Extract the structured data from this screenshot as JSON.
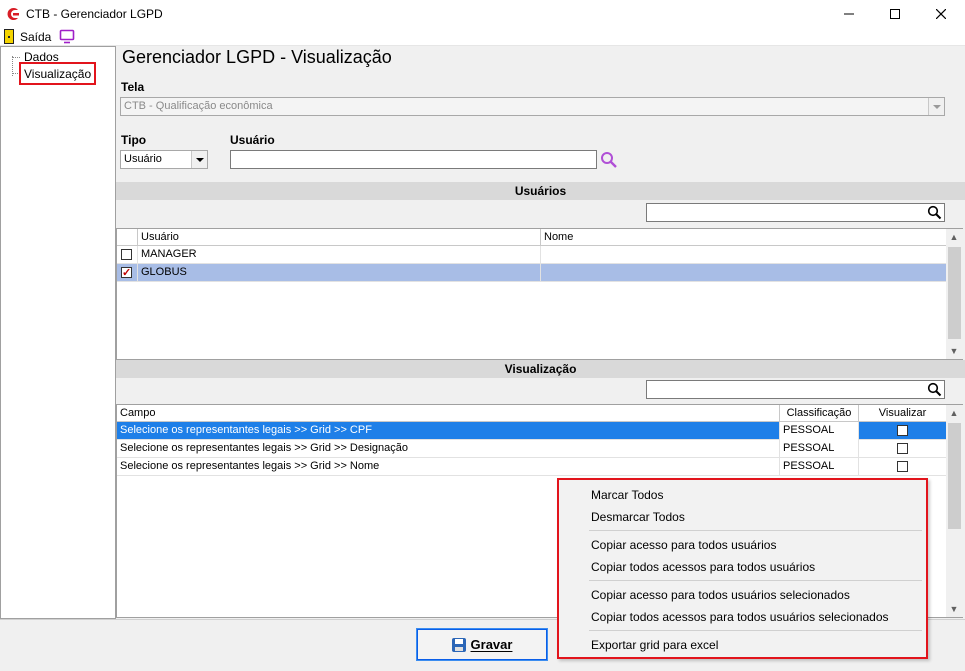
{
  "window": {
    "title": "CTB - Gerenciador LGPD"
  },
  "menubar": {
    "exit_label": "Saída"
  },
  "tree": {
    "items": [
      "Dados",
      "Visualização"
    ]
  },
  "page": {
    "title": "Gerenciador LGPD - Visualização"
  },
  "tela": {
    "label": "Tela",
    "value": "CTB - Qualificação econômica"
  },
  "tipo": {
    "label": "Tipo",
    "value": "Usuário"
  },
  "usuario": {
    "label": "Usuário",
    "value": ""
  },
  "usuarios_section": {
    "title": "Usuários",
    "search_value": "",
    "columns": [
      "Usuário",
      "Nome"
    ],
    "rows": [
      {
        "checked": false,
        "usuario": "MANAGER",
        "nome": ""
      },
      {
        "checked": true,
        "usuario": "GLOBUS",
        "nome": ""
      }
    ]
  },
  "visualizacao_section": {
    "title": "Visualização",
    "search_value": "",
    "columns": [
      "Campo",
      "Classificação",
      "Visualizar"
    ],
    "rows": [
      {
        "campo": "Selecione os representantes legais >> Grid >> CPF",
        "classificacao": "PESSOAL",
        "visualizar": false
      },
      {
        "campo": "Selecione os representantes legais >> Grid >> Designação",
        "classificacao": "PESSOAL",
        "visualizar": false
      },
      {
        "campo": "Selecione os representantes legais >> Grid >> Nome",
        "classificacao": "PESSOAL",
        "visualizar": false
      }
    ]
  },
  "footer": {
    "save_label": "Gravar"
  },
  "context_menu": {
    "items": [
      "Marcar Todos",
      "Desmarcar Todos",
      "Copiar acesso para todos usuários",
      "Copiar todos acessos para todos usuários",
      "Copiar acesso para todos usuários selecionados",
      "Copiar todos acessos para todos usuários selecionados",
      "Exportar grid para excel"
    ]
  },
  "colors": {
    "highlight_red": "#e2141c",
    "selection_blue": "#1e7fe8",
    "selection_light": "#a8bde6",
    "search_icon": "#b04fd6"
  },
  "icons": [
    "app-logo-icon",
    "exit-door-icon",
    "monitor-icon",
    "search-icon",
    "floppy-disk-icon",
    "checkbox-icon"
  ]
}
